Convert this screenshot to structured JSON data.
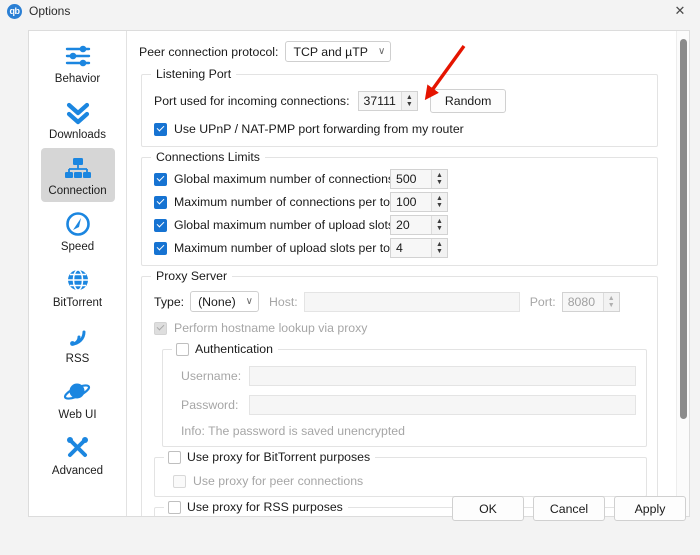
{
  "window": {
    "title": "Options",
    "logo_text": "qb",
    "logo_icon": "qbittorrent-logo-icon",
    "close_icon": "✕"
  },
  "sidebar": {
    "items": [
      {
        "label": "Behavior",
        "icon": "sliders-icon",
        "selected": false
      },
      {
        "label": "Downloads",
        "icon": "double-chevron-down-icon",
        "selected": false
      },
      {
        "label": "Connection",
        "icon": "network-icon",
        "selected": true
      },
      {
        "label": "Speed",
        "icon": "speedometer-icon",
        "selected": false
      },
      {
        "label": "BitTorrent",
        "icon": "globe-icon",
        "selected": false
      },
      {
        "label": "RSS",
        "icon": "rss-icon",
        "selected": false
      },
      {
        "label": "Web UI",
        "icon": "planet-icon",
        "selected": false
      },
      {
        "label": "Advanced",
        "icon": "tools-icon",
        "selected": false
      }
    ]
  },
  "connection": {
    "peer_protocol": {
      "label": "Peer connection protocol:",
      "value": "TCP and µTP",
      "chevron": "∨"
    },
    "listening_port": {
      "title": "Listening Port",
      "port_label": "Port used for incoming connections:",
      "port_value": "37111",
      "random_button": "Random",
      "upnp_label": "Use UPnP / NAT-PMP port forwarding from my router",
      "upnp_checked": true
    },
    "connections_limits": {
      "title": "Connections Limits",
      "rows": [
        {
          "label": "Global maximum number of connections:",
          "value": "500",
          "checked": true
        },
        {
          "label": "Maximum number of connections per torrent:",
          "value": "100",
          "checked": true
        },
        {
          "label": "Global maximum number of upload slots:",
          "value": "20",
          "checked": true
        },
        {
          "label": "Maximum number of upload slots per torrent:",
          "value": "4",
          "checked": true
        }
      ]
    },
    "proxy_server": {
      "title": "Proxy Server",
      "type_label": "Type:",
      "type_value": "(None)",
      "host_label": "Host:",
      "host_value": "",
      "port_label": "Port:",
      "port_value": "8080",
      "hostname_lookup_label": "Perform hostname lookup via proxy",
      "hostname_lookup_checked": true,
      "authentication": {
        "title": "Authentication",
        "checked": false,
        "username_label": "Username:",
        "username_value": "",
        "password_label": "Password:",
        "password_value": "",
        "info": "Info: The password is saved unencrypted"
      },
      "use_proxy_bittorrent": {
        "label": "Use proxy for BitTorrent purposes",
        "checked": false,
        "peer_connections_label": "Use proxy for peer connections",
        "peer_connections_checked": false
      },
      "use_proxy_rss": {
        "label": "Use proxy for RSS purposes",
        "checked": false
      }
    }
  },
  "footer": {
    "ok": "OK",
    "cancel": "Cancel",
    "apply": "Apply"
  },
  "annotation": {
    "color": "#e51400",
    "points_at": "Random"
  }
}
